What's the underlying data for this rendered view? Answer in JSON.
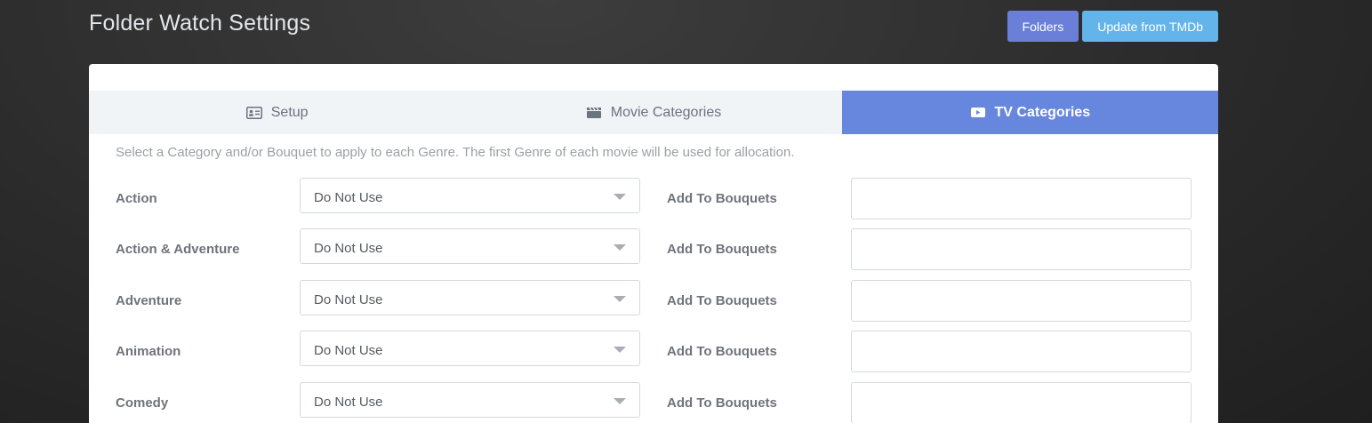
{
  "page": {
    "title": "Folder Watch Settings",
    "actions": {
      "folders_label": "Folders",
      "tmdb_label": "Update from TMDb"
    }
  },
  "tabs": [
    {
      "label": "Setup",
      "icon": "id-card-icon",
      "active": false
    },
    {
      "label": "Movie Categories",
      "icon": "clapperboard-icon",
      "active": false
    },
    {
      "label": "TV Categories",
      "icon": "tv-icon",
      "active": true
    }
  ],
  "intro_text": "Select a Category and/or Bouquet to apply to each Genre. The first Genre of each movie will be used for allocation.",
  "bouquet_label": "Add To Bouquets",
  "genres": [
    {
      "name": "Action",
      "category": "Do Not Use",
      "bouquets": ""
    },
    {
      "name": "Action & Adventure",
      "category": "Do Not Use",
      "bouquets": ""
    },
    {
      "name": "Adventure",
      "category": "Do Not Use",
      "bouquets": ""
    },
    {
      "name": "Animation",
      "category": "Do Not Use",
      "bouquets": ""
    },
    {
      "name": "Comedy",
      "category": "Do Not Use",
      "bouquets": ""
    }
  ],
  "colors": {
    "folders_button": "#6a7fd8",
    "tmdb_button": "#64b4ec",
    "active_tab": "#6787de"
  }
}
